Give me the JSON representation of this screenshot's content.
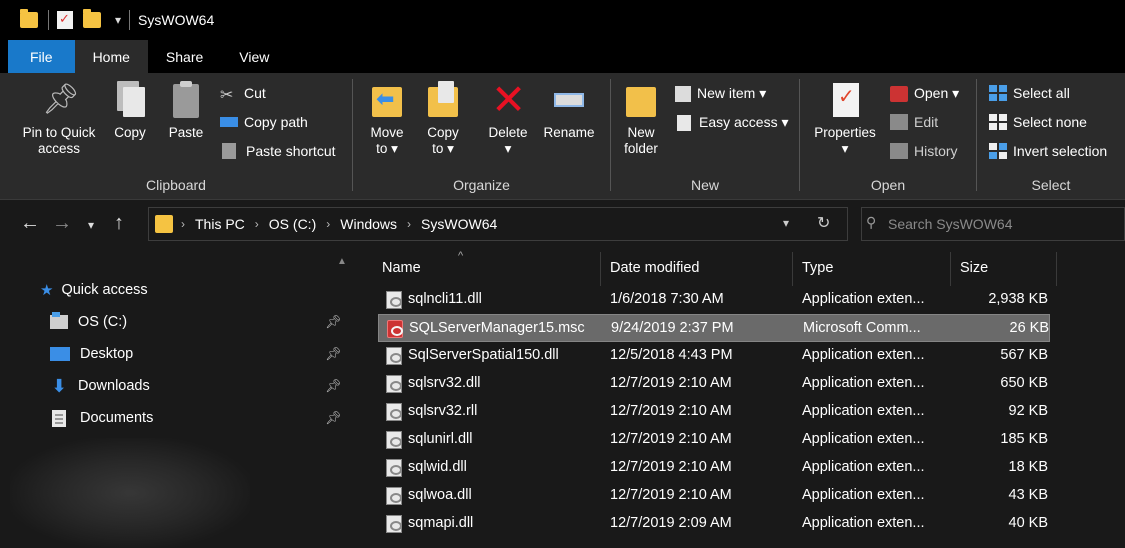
{
  "window": {
    "title": "SysWOW64"
  },
  "tabs": [
    "File",
    "Home",
    "Share",
    "View"
  ],
  "ribbon": {
    "clipboard": {
      "label": "Clipboard",
      "pin_label_1": "Pin to Quick",
      "pin_label_2": "access",
      "copy": "Copy",
      "paste": "Paste",
      "cut": "Cut",
      "copy_path": "Copy path",
      "paste_shortcut": "Paste shortcut"
    },
    "organize": {
      "label": "Organize",
      "move_to_1": "Move",
      "move_to_2": "to ▾",
      "copy_to_1": "Copy",
      "copy_to_2": "to ▾",
      "delete_1": "Delete",
      "delete_2": "▾",
      "rename": "Rename"
    },
    "new": {
      "label": "New",
      "new_folder_1": "New",
      "new_folder_2": "folder",
      "new_item": "New item ▾",
      "easy_access": "Easy access ▾"
    },
    "open": {
      "label": "Open",
      "properties_1": "Properties",
      "properties_2": "▾",
      "open": "Open ▾",
      "edit": "Edit",
      "history": "History"
    },
    "select": {
      "label": "Select",
      "select_all": "Select all",
      "select_none": "Select none",
      "invert_selection": "Invert selection"
    }
  },
  "address": {
    "crumbs": [
      "This PC",
      "OS (C:)",
      "Windows",
      "SysWOW64"
    ],
    "search_placeholder": "Search SysWOW64"
  },
  "nav_pane": {
    "items": [
      {
        "label": "Quick access",
        "icon": "star-icon",
        "pinned": false
      },
      {
        "label": "OS (C:)",
        "icon": "drive-icon",
        "pinned": true
      },
      {
        "label": "Desktop",
        "icon": "desktop-icon",
        "pinned": true
      },
      {
        "label": "Downloads",
        "icon": "download-icon",
        "pinned": true
      },
      {
        "label": "Documents",
        "icon": "documents-icon",
        "pinned": true
      }
    ]
  },
  "files": {
    "columns": [
      "Name",
      "Date modified",
      "Type",
      "Size"
    ],
    "rows": [
      {
        "name": "sqlncli11.dll",
        "date": "1/6/2018 7:30 AM",
        "type": "Application exten...",
        "size": "2,938 KB",
        "selected": false
      },
      {
        "name": "SQLServerManager15.msc",
        "date": "9/24/2019 2:37 PM",
        "type": "Microsoft Comm...",
        "size": "26 KB",
        "selected": true
      },
      {
        "name": "SqlServerSpatial150.dll",
        "date": "12/5/2018 4:43 PM",
        "type": "Application exten...",
        "size": "567 KB",
        "selected": false
      },
      {
        "name": "sqlsrv32.dll",
        "date": "12/7/2019 2:10 AM",
        "type": "Application exten...",
        "size": "650 KB",
        "selected": false
      },
      {
        "name": "sqlsrv32.rll",
        "date": "12/7/2019 2:10 AM",
        "type": "Application exten...",
        "size": "92 KB",
        "selected": false
      },
      {
        "name": "sqlunirl.dll",
        "date": "12/7/2019 2:10 AM",
        "type": "Application exten...",
        "size": "185 KB",
        "selected": false
      },
      {
        "name": "sqlwid.dll",
        "date": "12/7/2019 2:10 AM",
        "type": "Application exten...",
        "size": "18 KB",
        "selected": false
      },
      {
        "name": "sqlwoa.dll",
        "date": "12/7/2019 2:10 AM",
        "type": "Application exten...",
        "size": "43 KB",
        "selected": false
      },
      {
        "name": "sqmapi.dll",
        "date": "12/7/2019 2:09 AM",
        "type": "Application exten...",
        "size": "40 KB",
        "selected": false
      }
    ]
  },
  "colors": {
    "file_tab": "#1979ca",
    "ribbon_bg": "#2b2b2b",
    "window_bg": "#191919",
    "selection": "#6a6a6a",
    "folder": "#f5c342",
    "accent_blue": "#3a8ee6",
    "delete_red": "#e81123"
  }
}
